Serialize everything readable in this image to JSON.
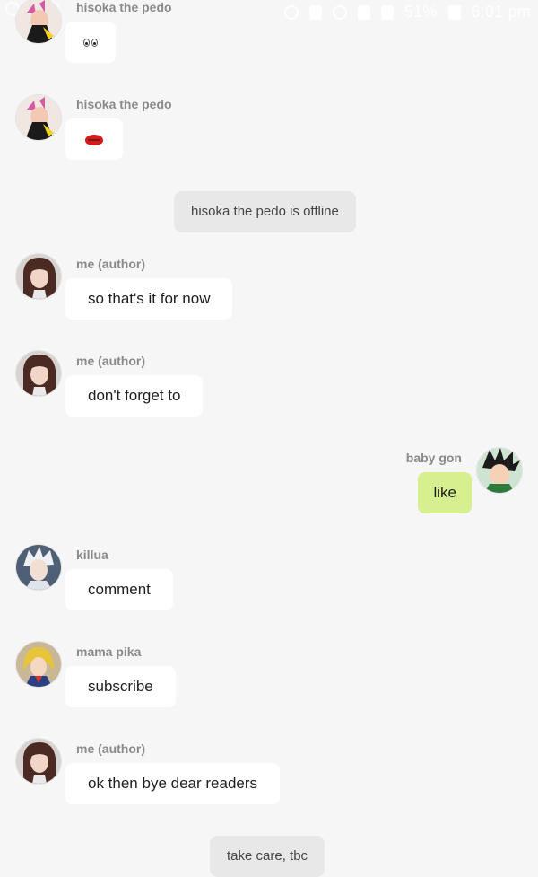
{
  "status_bar": {
    "battery": "51%",
    "time": "6:01 pm"
  },
  "messages": [
    {
      "type": "incoming",
      "sender": "hisoka the pedo",
      "text": "👀",
      "avatar": "hisoka-avatar"
    },
    {
      "type": "incoming",
      "sender": "hisoka the pedo",
      "text": "💋",
      "avatar": "hisoka-avatar"
    },
    {
      "type": "system",
      "text": "hisoka the pedo is offline"
    },
    {
      "type": "incoming",
      "sender": "me (author)",
      "text": "so that's it for now",
      "avatar": "author-avatar"
    },
    {
      "type": "incoming",
      "sender": "me (author)",
      "text": "don't forget to",
      "avatar": "author-avatar"
    },
    {
      "type": "outgoing",
      "sender": "baby gon",
      "text": "like",
      "avatar": "gon-avatar"
    },
    {
      "type": "incoming",
      "sender": "killua",
      "text": "comment",
      "avatar": "killua-avatar"
    },
    {
      "type": "incoming",
      "sender": "mama pika",
      "text": "subscribe",
      "avatar": "pika-avatar"
    },
    {
      "type": "incoming",
      "sender": "me (author)",
      "text": "ok then bye dear readers",
      "avatar": "author-avatar"
    },
    {
      "type": "system",
      "text": "take care, tbc"
    }
  ],
  "colors": {
    "background": "#f6f6f6",
    "incoming_bubble": "#ffffff",
    "outgoing_bubble": "#d7f08f",
    "system_bubble": "#e8e8e8",
    "sender_text": "#8a8a8a"
  }
}
